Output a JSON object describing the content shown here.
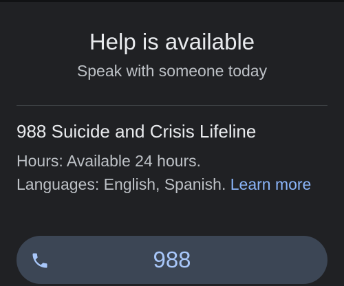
{
  "header": {
    "title": "Help is available",
    "subtitle": "Speak with someone today"
  },
  "resource": {
    "name": "988 Suicide and Crisis Lifeline",
    "hours": "Hours: Available 24 hours.",
    "languages": "Languages: English, Spanish.",
    "learn_more_label": "Learn more"
  },
  "call_button": {
    "number": "988",
    "icon": "phone-icon"
  },
  "colors": {
    "background": "#202124",
    "link": "#8ab4f8",
    "button_background": "#3c4655",
    "button_text": "#a8c7fa"
  }
}
